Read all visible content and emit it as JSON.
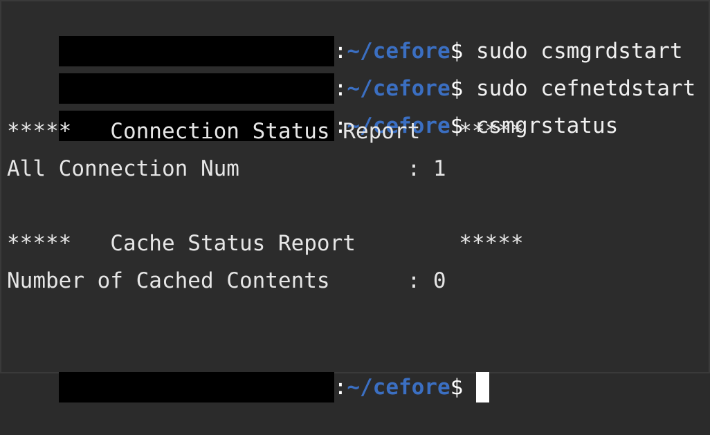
{
  "prompt": {
    "colon": ":",
    "path": "~/cefore",
    "symbol": "$ "
  },
  "commands": [
    "sudo csmgrdstart",
    "sudo cefnetdstart",
    "csmgrstatus"
  ],
  "output": {
    "connection_header": "*****   Connection Status Report   *****",
    "connection_num_line": "All Connection Num             : 1",
    "cache_header": "*****   Cache Status Report        *****",
    "cached_contents_line": "Number of Cached Contents      : 0"
  },
  "colors": {
    "background": "#2c2c2c",
    "path": "#3b6fc2",
    "text": "#e6e6e6",
    "redaction": "#000000"
  }
}
